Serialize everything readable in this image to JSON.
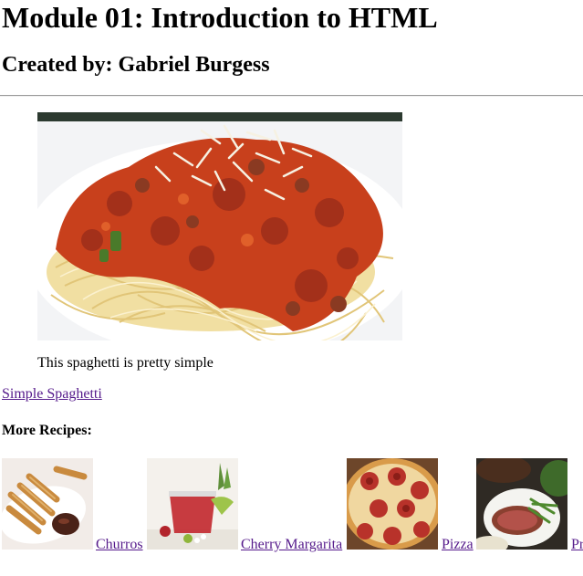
{
  "header": {
    "title": "Module 01: Introduction to HTML",
    "author": "Created by: Gabriel Burgess"
  },
  "main": {
    "image_subject": "Spaghetti with meat sauce topped with grated parmesan",
    "caption": "This spaghetti is pretty simple",
    "link_label": "Simple Spaghetti"
  },
  "more_recipes": {
    "heading": "More Recipes:",
    "items": [
      {
        "label": "Churros",
        "image_subject": "Churros in a white dish with chocolate sauce"
      },
      {
        "label": "Cherry Margarita",
        "image_subject": "Red cherry margarita in glasses with lime"
      },
      {
        "label": "Pizza",
        "image_subject": "Pepperoni pizza on a wooden board"
      },
      {
        "label": "Pr",
        "image_subject": "Sliced prime rib with green beans"
      }
    ]
  },
  "colors": {
    "visited_link": "#551a8b",
    "rule": "#9a9a9a",
    "sauce": "#c8401c",
    "pasta": "#f1dfa2"
  }
}
